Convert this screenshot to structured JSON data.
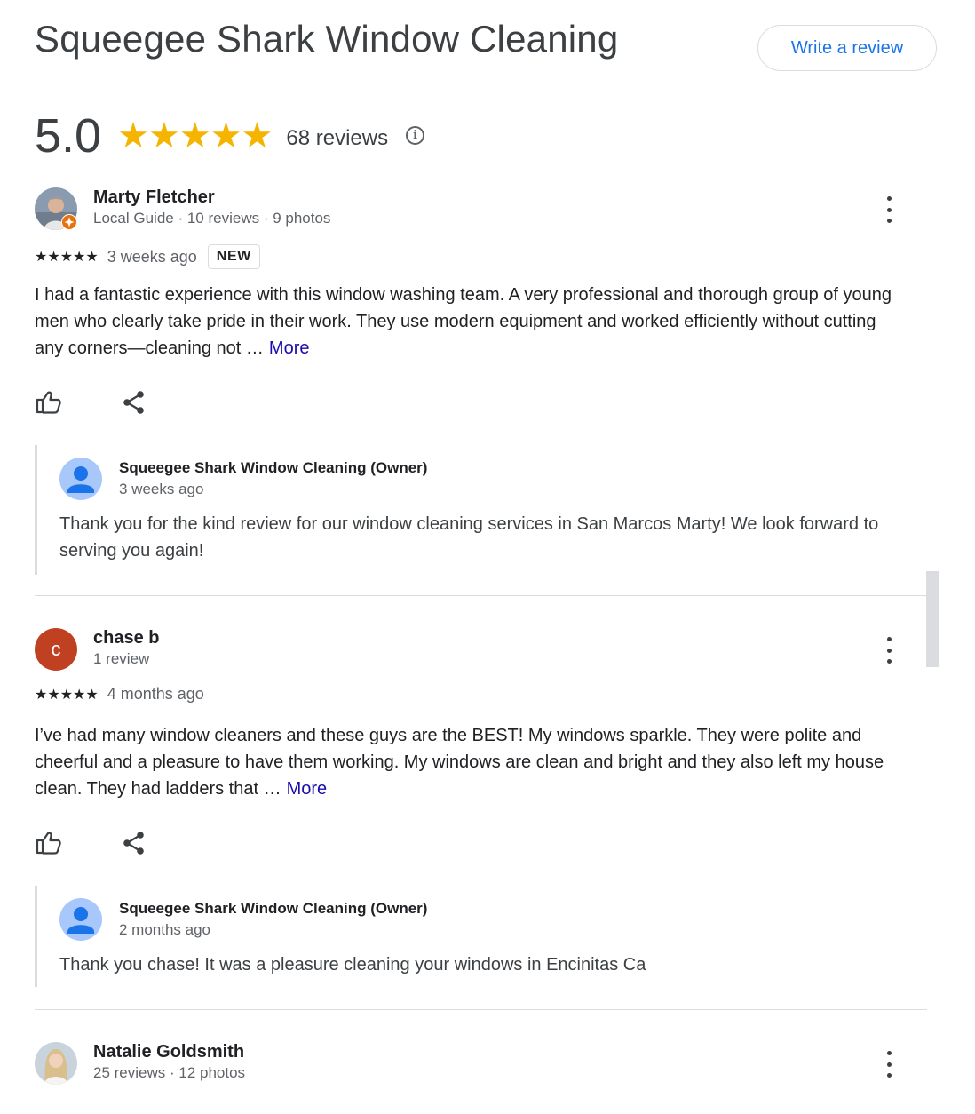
{
  "header": {
    "title": "Squeegee Shark Window Cleaning",
    "write_review_label": "Write a review"
  },
  "summary": {
    "rating": "5.0",
    "stars": "★★★★★",
    "review_count": "68 reviews",
    "info_icon": "i"
  },
  "reviews": [
    {
      "name": "Marty Fletcher",
      "meta": "Local Guide · 10 reviews · 9 photos",
      "stars": "★★★★★",
      "when": "3 weeks ago",
      "badge": "NEW",
      "text": "I had a fantastic experience with this window washing team. A very professional and thorough group of young men who clearly take pride in their work. They use modern equipment and worked efficiently without cutting any corners—cleaning not …",
      "more": "More",
      "reply": {
        "name": "Squeegee Shark Window Cleaning (Owner)",
        "when": "3 weeks ago",
        "text": "Thank you for the kind review for our window cleaning services in San Marcos Marty! We look forward to serving you again!"
      }
    },
    {
      "name": "chase b",
      "initial": "c",
      "meta": "1 review",
      "stars": "★★★★★",
      "when": "4 months ago",
      "text": "I’ve had many window cleaners and these guys are the BEST! My windows sparkle. They were polite and cheerful and a pleasure to have them working. My windows are clean and bright and they also left my house clean. They had ladders that …",
      "more": "More",
      "reply": {
        "name": "Squeegee Shark Window Cleaning (Owner)",
        "when": "2 months ago",
        "text": "Thank you chase! It was a pleasure cleaning your windows in Encinitas Ca"
      }
    },
    {
      "name": "Natalie Goldsmith",
      "meta": "25 reviews · 12 photos"
    }
  ],
  "colors": {
    "accent": "#1a73e8",
    "star": "#f4b400",
    "link": "#1a0dab",
    "letter_avatar": "#bf4122"
  }
}
